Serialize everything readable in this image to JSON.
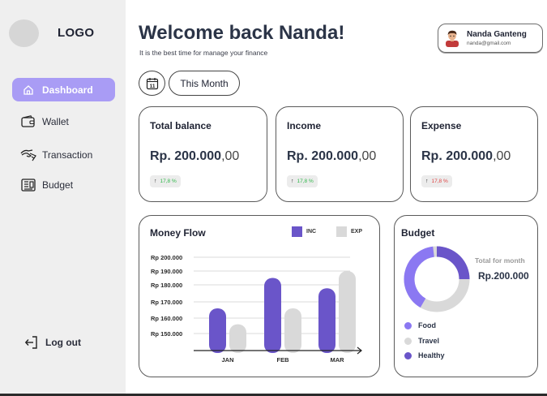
{
  "app": {
    "logo": "LOGO"
  },
  "sidebar": {
    "items": [
      {
        "label": "Dashboard",
        "icon": "home-icon",
        "active": true
      },
      {
        "label": "Wallet",
        "icon": "wallet-icon",
        "active": false
      },
      {
        "label": "Transaction",
        "icon": "transaction-icon",
        "active": false
      },
      {
        "label": "Budget",
        "icon": "budget-icon",
        "active": false
      }
    ],
    "logout_label": "Log out"
  },
  "header": {
    "welcome": "Welcome back Nanda!",
    "subtitle": "It is the best time for manage your finance"
  },
  "user": {
    "name": "Nanda Ganteng",
    "email": "nanda@gmail.com"
  },
  "filter": {
    "period_label": "This Month",
    "calendar_day": "11"
  },
  "stats": [
    {
      "title": "Total balance",
      "amount": "Rp. 200.000",
      "decimals": ",00",
      "change": "17,8 %",
      "direction": "up"
    },
    {
      "title": "Income",
      "amount": "Rp. 200.000",
      "decimals": ",00",
      "change": "17,8 %",
      "direction": "up"
    },
    {
      "title": "Expense",
      "amount": "Rp. 200.000",
      "decimals": ",00",
      "change": "17,8 %",
      "direction": "down"
    }
  ],
  "money_flow": {
    "title": "Money Flow",
    "legend": [
      {
        "name": "INC",
        "color": "#6a55c9"
      },
      {
        "name": "EXP",
        "color": "#d9d9d9"
      }
    ]
  },
  "chart_data": {
    "type": "bar",
    "categories": [
      "JAN",
      "FEB",
      "MAR"
    ],
    "series": [
      {
        "name": "INC",
        "values": [
          166000,
          185000,
          178000
        ]
      },
      {
        "name": "EXP",
        "values": [
          156000,
          166000,
          190000
        ]
      }
    ],
    "y_tick_labels": [
      "Rp 200.000",
      "Rp 190.000",
      "Rp 180.000",
      "Rp 170.000",
      "Rp 160.000",
      "Rp 150.000"
    ],
    "y_tick_values": [
      200000,
      190000,
      180000,
      170000,
      160000,
      150000
    ],
    "grid": true,
    "legend": "top-right"
  },
  "budget": {
    "title": "Budget",
    "total_label": "Total for month",
    "total_value": "Rp.200.000",
    "categories": [
      {
        "name": "Food",
        "color": "#8b78f2"
      },
      {
        "name": "Travel",
        "color": "#d9d9d9"
      },
      {
        "name": "Healthy",
        "color": "#6a55c9"
      }
    ]
  },
  "colors": {
    "accent": "#a99cf5",
    "income": "#6a55c9",
    "expense": "#d9d9d9",
    "up": "#2fb84a",
    "down": "#e04343"
  }
}
